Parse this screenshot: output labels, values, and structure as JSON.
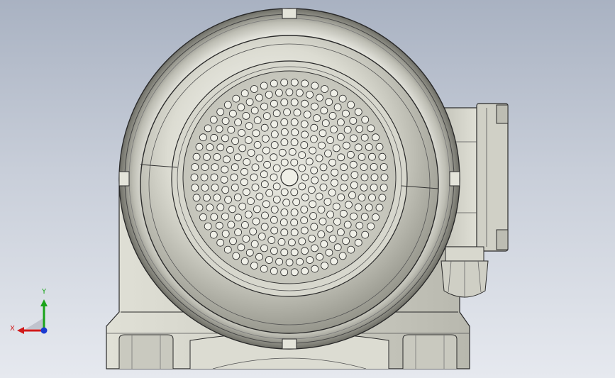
{
  "viewport": {
    "background_top": "#a9b2c2",
    "background_bottom": "#e6e9ef"
  },
  "model": {
    "name": "motor-rear-view",
    "housing_color": "#d6d6cc",
    "edge_color": "#2a2a2a"
  },
  "triad": {
    "x_label": "X",
    "y_label": "Y",
    "x_color": "#d11a1a",
    "y_color": "#19a319",
    "z_color": "#1a3ad1"
  }
}
